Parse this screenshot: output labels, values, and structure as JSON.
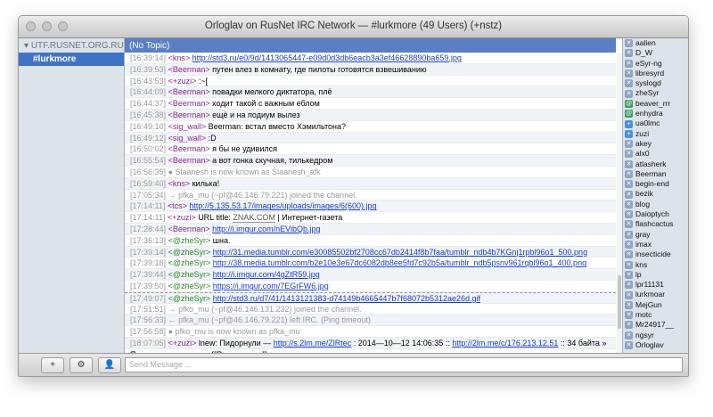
{
  "window": {
    "title": "Orloglav on RusNet IRC Network — #lurkmore (49 Users) (+nstz)"
  },
  "sidebar": {
    "server": "UTF.RUSNET.ORG.RU",
    "channel": "#lurkmore"
  },
  "topic": "(No Topic)",
  "messages": [
    {
      "ts": "[16:39:14]",
      "nick": "<kns>",
      "text": "",
      "link": "http://std3.ru/e0/9d/1413065447-e09d0d3db6eacb3a3ef46628890ba659.jpg"
    },
    {
      "ts": "[16:39:53]",
      "nick": "<Beerman>",
      "text": "путен влез в комнату, где пилоты готовятся взвешиванию"
    },
    {
      "ts": "[16:43:53]",
      "nick": "<+zuzi>",
      "text": ":~["
    },
    {
      "ts": "[16:44:09]",
      "nick": "<Beerman>",
      "text": "повадки мелкого диктатора, плё"
    },
    {
      "ts": "[16:44:37]",
      "nick": "<Beerman>",
      "text": "ходит такой с важным еблом"
    },
    {
      "ts": "[16:45:38]",
      "nick": "<Beerman>",
      "text": "ещё и на подиум вылез"
    },
    {
      "ts": "[16:49:10]",
      "nick": "<sig_wall>",
      "text": "Beerman: встал вместо Хэмильтона?"
    },
    {
      "ts": "[16:49:12]",
      "nick": "<sig_wall>",
      "text": ":D"
    },
    {
      "ts": "[16:50:02]",
      "nick": "<Beerman>",
      "text": "я бы не удивился"
    },
    {
      "ts": "[16:55:54]",
      "nick": "<Beerman>",
      "text": "а вот гонка скучная, тилькедром"
    },
    {
      "ts": "[16:56:35]",
      "sys": "● Slaanesh is now known as Slaanesh_afk"
    },
    {
      "ts": "[16:59:40]",
      "nick": "<kns>",
      "text": "килька!"
    },
    {
      "ts": "[17:05:34]",
      "join": "→ pfka_mu (~pf@46.146.79.221) joined the channel."
    },
    {
      "ts": "[17:14:11]",
      "nick": "<tcs>",
      "text": "",
      "link": "http://5.135.53.17/images/uploads/images/6(600).jpg"
    },
    {
      "ts": "[17:14:11]",
      "nick": "<+zuzi>",
      "text": "URL title: ",
      "extra_link": "ZNAK.COM",
      "extra_text": " | Интернет-газета"
    },
    {
      "ts": "[17:28:44]",
      "nick": "<Beerman>",
      "text": "",
      "link": "http://i.imgur.com/nEVibQb.jpg"
    },
    {
      "ts": "[17:36:13]",
      "nick": "<@zheSyr>",
      "text": "шна."
    },
    {
      "ts": "[17:39:14]",
      "nick": "<@zheSyr>",
      "text": "",
      "link": "http://31.media.tumblr.com/e30085502bf2708cc67db2414f8b7faa/tumblr_ndb4b7KGnj1rpbl96o1_500.png"
    },
    {
      "ts": "[17:39:18]",
      "nick": "<@zheSyr>",
      "text": "",
      "link": "http://38.media.tumblr.com/b2e10e3e67dc6082db8ee5fd7c92b5a/tumblr_ndb5psnv961rqbl96o1_400.png"
    },
    {
      "ts": "[17:39:44]",
      "nick": "<@zheSyr>",
      "text": "",
      "link": "http://i.imgur.com/4gZtR59.jpg"
    },
    {
      "ts": "[17:39:50]",
      "nick": "<@zheSyr>",
      "text": "",
      "link": "https://i.imgur.com/7EGrFW6.jpg"
    },
    {
      "ts": "[17:49:07]",
      "nick": "<@zheSyr>",
      "text": "",
      "link": "http://std3.ru/d7/41/1413121383-d74149b4665447b7f68072b5312ae26d.gif"
    },
    {
      "ts": "[17:51:51]",
      "join": "→ pfko_mu (~pf@46.146.131.232) joined the channel."
    },
    {
      "ts": "[17:56:33]",
      "part": "← pfka_mu (~pf@46.146.79.221) left IRC. (Ping timeout)"
    },
    {
      "ts": "[17:56:58]",
      "sys": "● pfko_mu is now known as pfka_mu"
    },
    {
      "ts": "[18:07:05]",
      "nick": "<+zuzi>",
      "text": "lnew: Пидорнули — ",
      "link": "http://s.2lm.me/ZlRtec",
      "extra_text": " : 2014—10—12 14:06:35 :: ",
      "extra_link": "http://2lm.me/c/176.213.12.51",
      "tail": " :: 34 байта »"
    },
    {
      "ts": "",
      "nick": "",
      "text": "Переналравление на [[Пидорнутые]]"
    }
  ],
  "users": [
    {
      "name": "aalien",
      "mode": ""
    },
    {
      "name": "D_W",
      "mode": ""
    },
    {
      "name": "eSyr-ng",
      "mode": ""
    },
    {
      "name": "libresyrd",
      "mode": ""
    },
    {
      "name": "syslogd",
      "mode": ""
    },
    {
      "name": "zheSyr",
      "mode": ""
    },
    {
      "name": "beaver_rrr",
      "mode": "op"
    },
    {
      "name": "enhydra",
      "mode": "op"
    },
    {
      "name": "ua0lmc",
      "mode": "voice"
    },
    {
      "name": "zuzi",
      "mode": "voice"
    },
    {
      "name": "akey",
      "mode": ""
    },
    {
      "name": "alx0",
      "mode": ""
    },
    {
      "name": "atlasherk",
      "mode": ""
    },
    {
      "name": "Beerman",
      "mode": ""
    },
    {
      "name": "begin-end",
      "mode": ""
    },
    {
      "name": "bezik",
      "mode": ""
    },
    {
      "name": "blog",
      "mode": ""
    },
    {
      "name": "Daioptych",
      "mode": ""
    },
    {
      "name": "flashcactus",
      "mode": ""
    },
    {
      "name": "gray",
      "mode": ""
    },
    {
      "name": "imax",
      "mode": ""
    },
    {
      "name": "insecticide",
      "mode": ""
    },
    {
      "name": "kns",
      "mode": ""
    },
    {
      "name": "lp",
      "mode": ""
    },
    {
      "name": "lpr11131",
      "mode": ""
    },
    {
      "name": "lurkmoar",
      "mode": ""
    },
    {
      "name": "MejGun",
      "mode": ""
    },
    {
      "name": "motc",
      "mode": ""
    },
    {
      "name": "Mr24917__",
      "mode": ""
    },
    {
      "name": "ngsyr",
      "mode": ""
    },
    {
      "name": "Orloglav",
      "mode": ""
    }
  ],
  "toolbar": {
    "add": "+",
    "settings_icon": "gear-icon",
    "user_icon": "person-icon"
  },
  "input": {
    "placeholder": "Send Message ..."
  },
  "colors": {
    "selection": "#3f74c4",
    "topic": "#5b7fc2",
    "link": "#1a3fbf",
    "nick": "#8b2a8b",
    "join": "#2d8a2d",
    "part": "#c0392b"
  }
}
